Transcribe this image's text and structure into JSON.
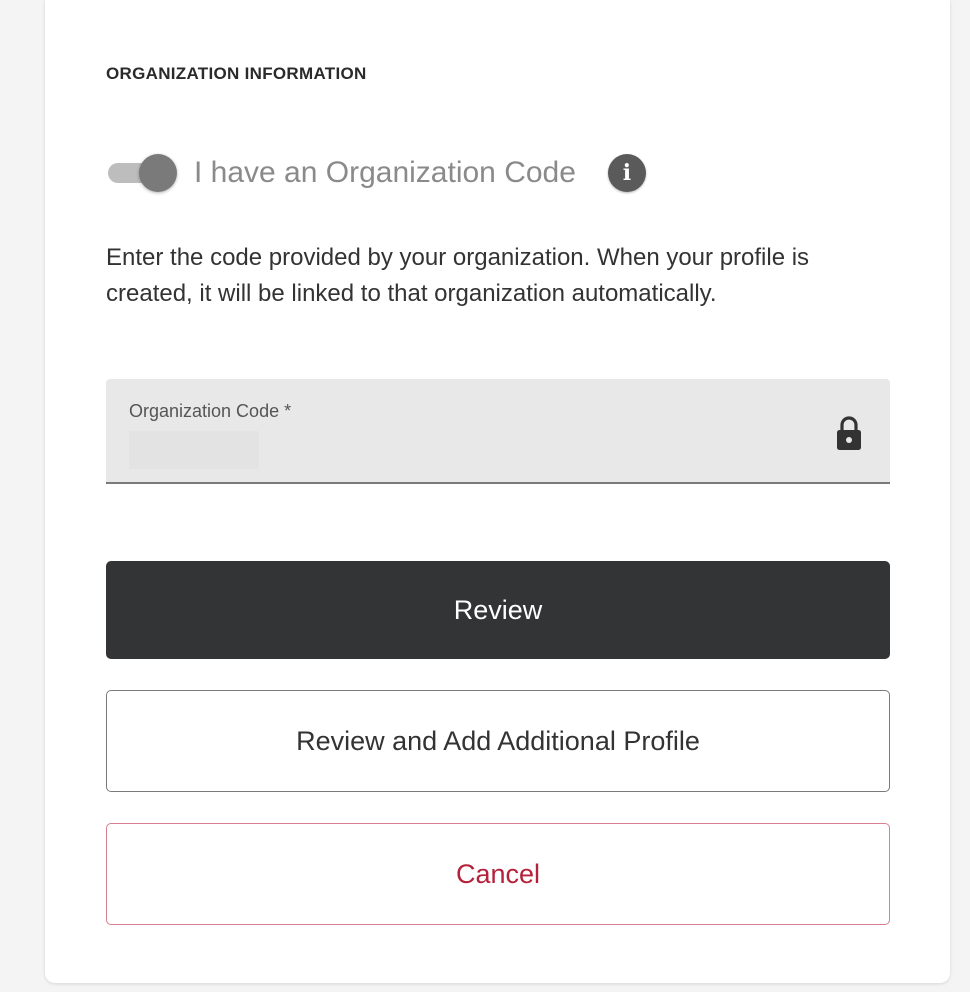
{
  "section": {
    "heading": "ORGANIZATION INFORMATION"
  },
  "toggle": {
    "label": "I have an Organization Code",
    "checked": true,
    "info_icon": "info-icon"
  },
  "description": "Enter the code provided by your organization. When your profile is created, it will be linked to that organization automatically.",
  "field": {
    "label": "Organization Code *",
    "value": "",
    "icon": "lock-icon"
  },
  "buttons": {
    "review": "Review",
    "review_add": "Review and Add Additional Profile",
    "cancel": "Cancel"
  },
  "colors": {
    "primary_button_bg": "#333436",
    "cancel_text": "#b4213b",
    "cancel_border": "#d77f8e",
    "field_bg": "#e8e8e8"
  }
}
